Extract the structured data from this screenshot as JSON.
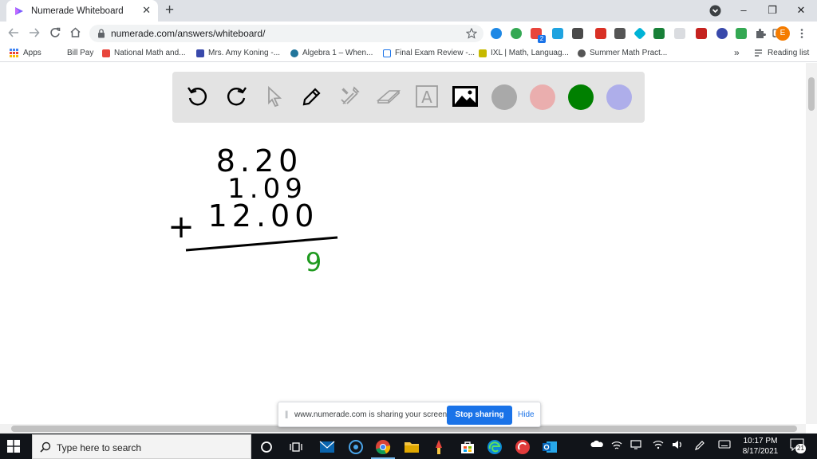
{
  "browser": {
    "tab": {
      "title": "Numerade Whiteboard",
      "close": "✕"
    },
    "new_tab": "+",
    "window_controls": {
      "minimize": "–",
      "restore": "❐",
      "close": "✕"
    },
    "url": "numerade.com/answers/whiteboard/",
    "profile_initial": "E",
    "badge_count": "2"
  },
  "bookmarks": [
    {
      "label": "Apps",
      "icon": "apps-grid-icon",
      "color": "#4285f4"
    },
    {
      "label": "Bill Pay",
      "icon": "blank-icon",
      "color": "#ffffff"
    },
    {
      "label": "National Math and...",
      "icon": "x-logo-icon",
      "color": "#e8453c"
    },
    {
      "label": "Mrs. Amy Koning -...",
      "icon": "site-icon",
      "color": "#3949ab"
    },
    {
      "label": "Algebra 1 – When...",
      "icon": "wordpress-icon",
      "color": "#21759b"
    },
    {
      "label": "Final Exam Review -...",
      "icon": "doc-icon",
      "color": "#1a73e8"
    },
    {
      "label": "IXL | Math, Languag...",
      "icon": "ixl-icon",
      "color": "#c6b900"
    },
    {
      "label": "Summer Math Pract...",
      "icon": "globe-icon",
      "color": "#555555"
    }
  ],
  "reading_list": "Reading list",
  "bookmarks_overflow": "»",
  "whiteboard": {
    "tools": [
      "undo",
      "redo",
      "select",
      "pen",
      "tools",
      "eraser",
      "text",
      "image"
    ],
    "text_tool_glyph": "A",
    "colors": [
      "#a9a9a9",
      "#eaaeae",
      "#008000",
      "#aeaeea"
    ],
    "ink": "#000000",
    "answer_ink": "#1f9a1f",
    "problem": {
      "line1": "8.20",
      "line2": "1.09",
      "line3": "12.00",
      "operator": "+",
      "answer": "9"
    }
  },
  "sharing": {
    "grip": "||",
    "message": "www.numerade.com is sharing your screen.",
    "stop": "Stop sharing",
    "hide": "Hide"
  },
  "taskbar": {
    "search_placeholder": "Type here to search",
    "time": "10:17 PM",
    "date": "8/17/2021",
    "notification_count": "21"
  }
}
